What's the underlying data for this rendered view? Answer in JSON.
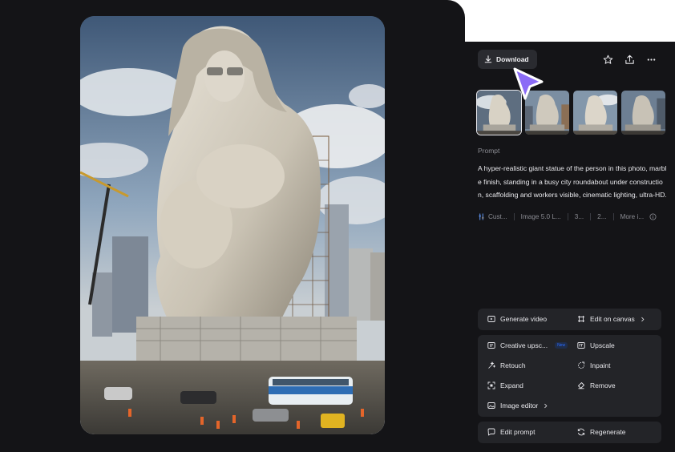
{
  "toolbar": {
    "download_label": "Download",
    "icons": [
      "download-icon",
      "star-icon",
      "share-icon",
      "more-icon"
    ]
  },
  "thumbnails": [
    {
      "selected": true
    },
    {
      "selected": false
    },
    {
      "selected": false
    },
    {
      "selected": false
    }
  ],
  "prompt": {
    "label": "Prompt",
    "text": "A hyper-realistic giant statue of the person in this photo, marble finish, standing in a busy city roundabout under construction, scaffolding and workers visible, cinematic lighting, ultra-HD."
  },
  "meta": {
    "style": "Cust...",
    "model": "Image 5.0 L...",
    "ratio": "3...",
    "count": "2...",
    "more": "More i..."
  },
  "actions": {
    "generate_video": "Generate video",
    "edit_on_canvas": "Edit on canvas",
    "creative_upscale": "Creative upsc...",
    "new_badge": "New",
    "upscale": "Upscale",
    "retouch": "Retouch",
    "inpaint": "Inpaint",
    "expand": "Expand",
    "remove": "Remove",
    "image_editor": "Image editor",
    "edit_prompt": "Edit prompt",
    "regenerate": "Regenerate"
  },
  "colors": {
    "background": "#141417",
    "panel_button": "#2a2b30",
    "action_group": "#232428",
    "cursor_accent": "#8b6cf6"
  }
}
